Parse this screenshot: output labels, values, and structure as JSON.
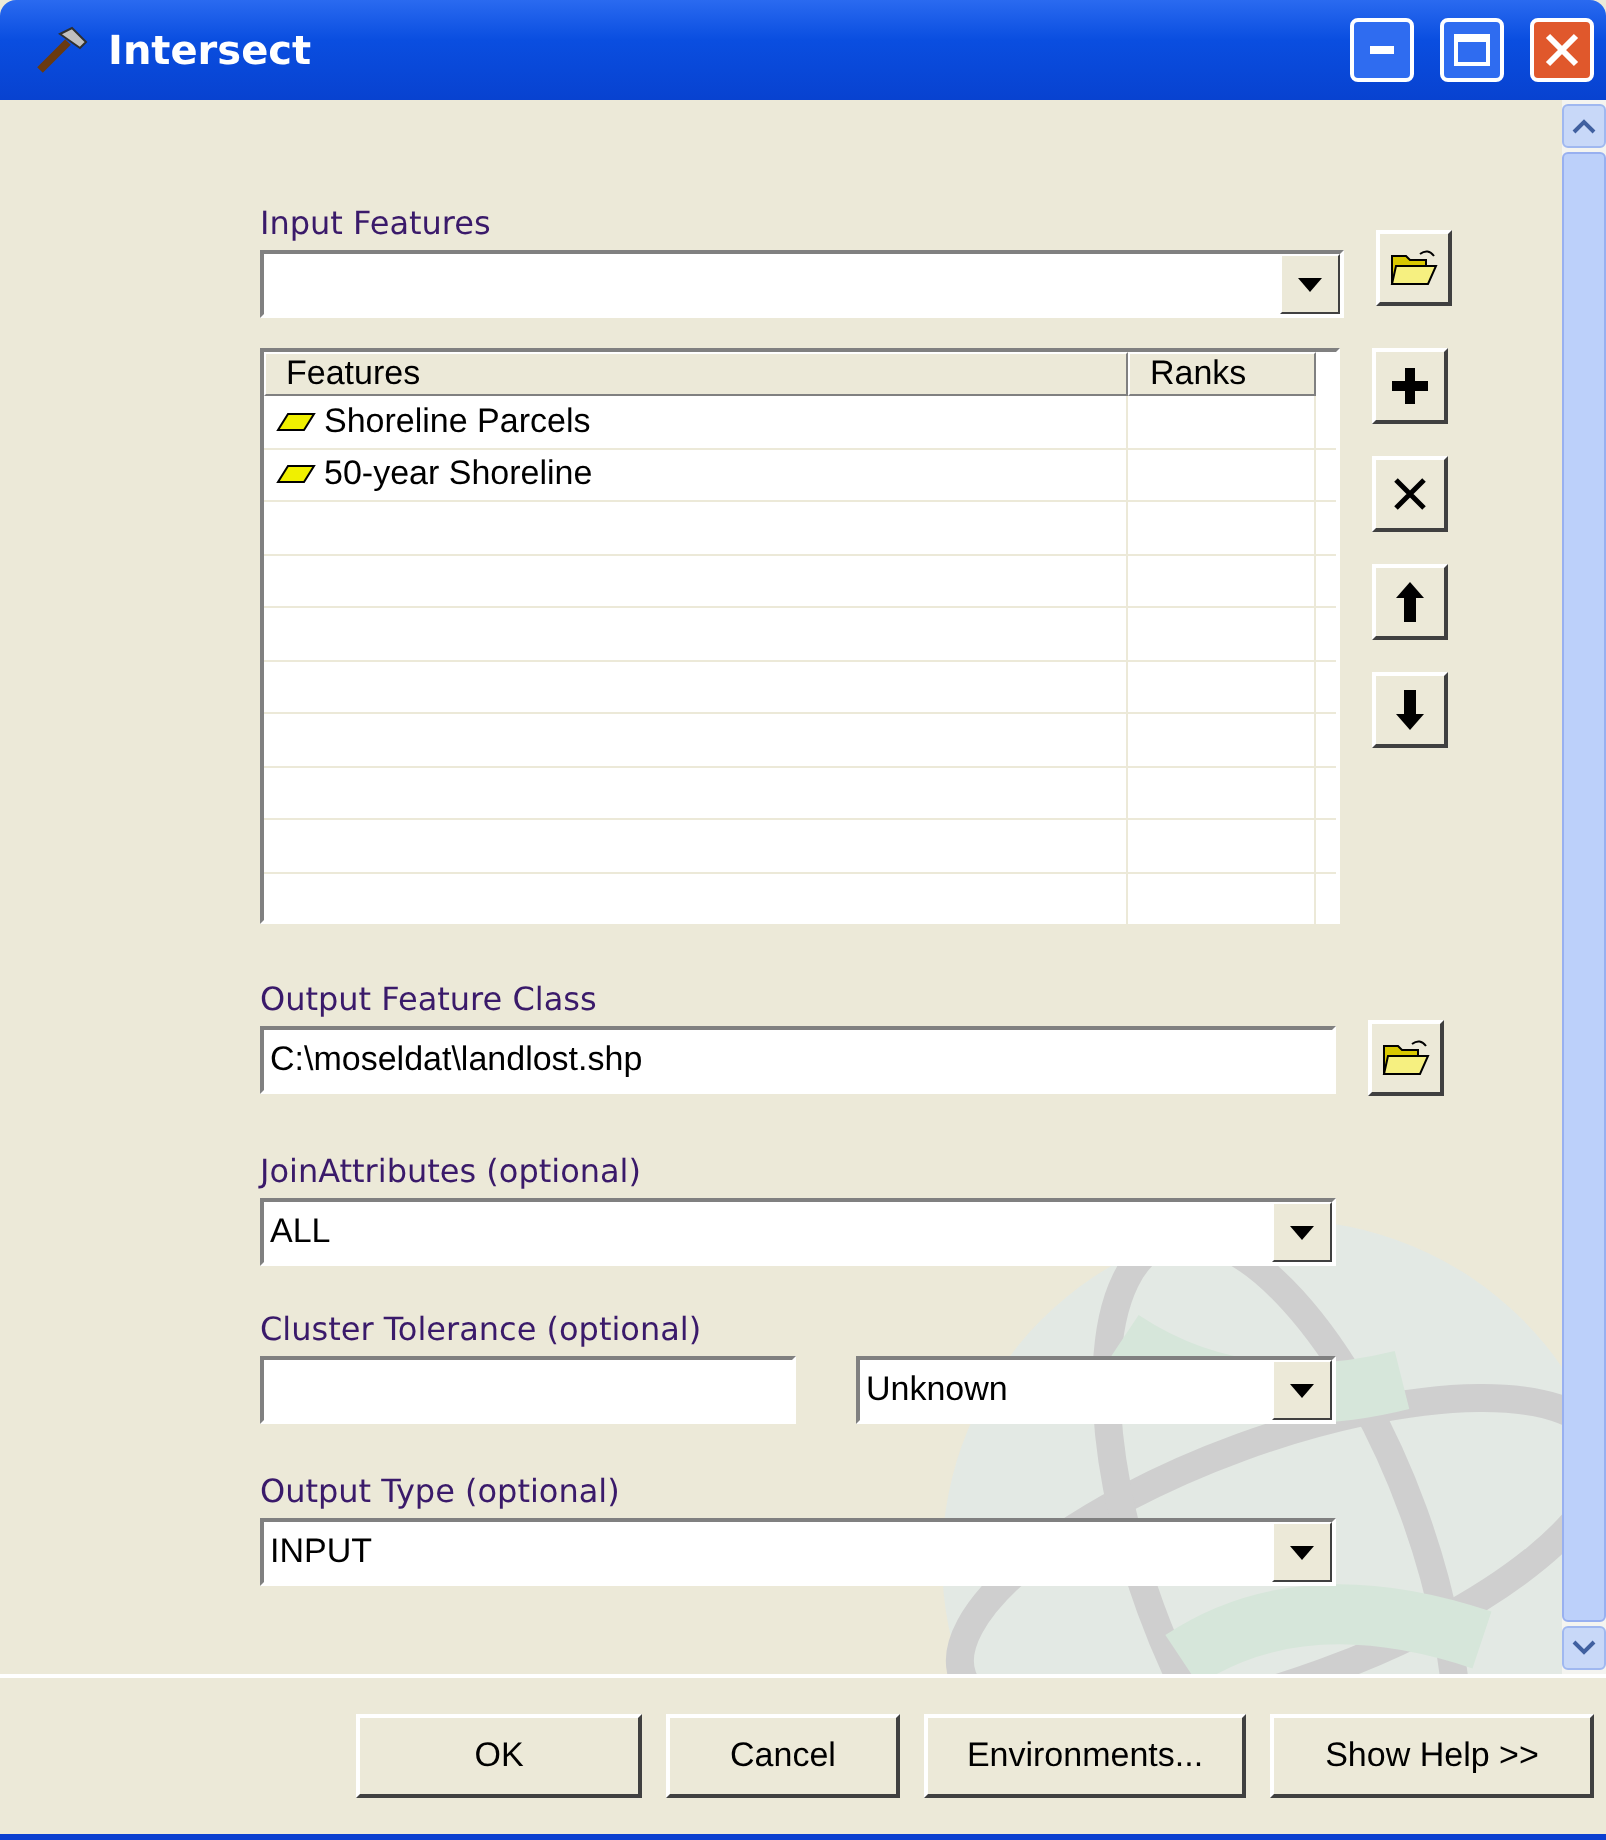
{
  "window": {
    "title": "Intersect"
  },
  "input_features": {
    "label": "Input Features",
    "table": {
      "columns": [
        "Features",
        "Ranks"
      ],
      "rows": [
        {
          "name": "Shoreline Parcels"
        },
        {
          "name": "50-year Shoreline"
        }
      ]
    }
  },
  "output_feature_class": {
    "label": "Output Feature Class",
    "value": "C:\\moseldat\\landlost.shp"
  },
  "join_attributes": {
    "label": "JoinAttributes (optional)",
    "value": "ALL"
  },
  "cluster_tolerance": {
    "label": "Cluster Tolerance (optional)",
    "unit": "Unknown"
  },
  "output_type": {
    "label": "Output Type (optional)",
    "value": "INPUT"
  },
  "buttons": [
    "OK",
    "Cancel",
    "Environments...",
    "Show Help >>"
  ]
}
